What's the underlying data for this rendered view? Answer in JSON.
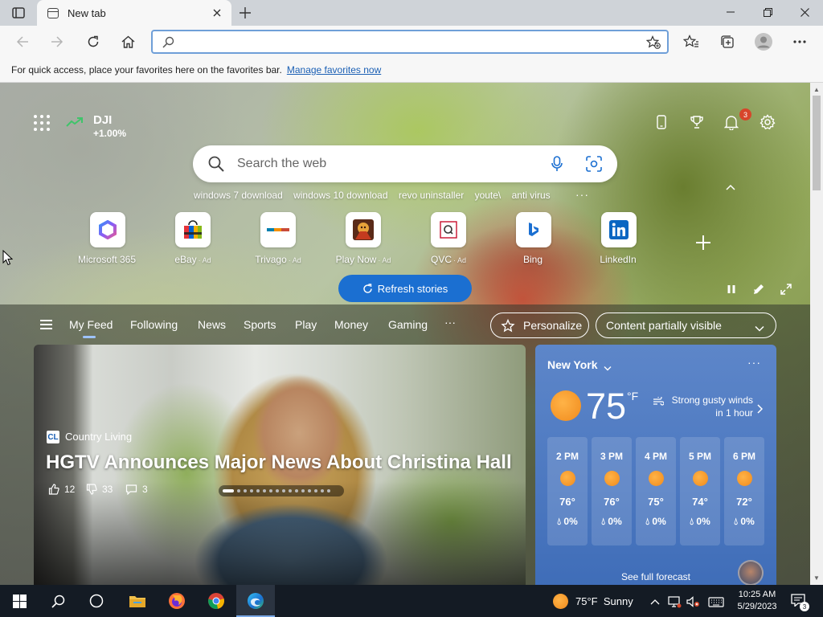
{
  "browser": {
    "tab_title": "New tab",
    "address_value": "",
    "favorites_prompt": "For quick access, place your favorites here on the favorites bar.",
    "favorites_link": "Manage favorites now"
  },
  "top_row": {
    "stock_symbol": "DJI",
    "stock_change": "+1.00%",
    "notification_count": "3"
  },
  "search": {
    "placeholder": "Search the web",
    "suggestions": [
      "windows 7 download",
      "windows 10 download",
      "revo uninstaller",
      "youte\\",
      "anti virus"
    ],
    "more": "···"
  },
  "quick_links": [
    {
      "label": "Microsoft 365",
      "ad": ""
    },
    {
      "label": "eBay",
      "ad": "· Ad"
    },
    {
      "label": "Trivago",
      "ad": "· Ad"
    },
    {
      "label": "Play Now",
      "ad": "· Ad"
    },
    {
      "label": "QVC",
      "ad": "· Ad"
    },
    {
      "label": "Bing",
      "ad": ""
    },
    {
      "label": "LinkedIn",
      "ad": ""
    }
  ],
  "feed": {
    "tabs": [
      "My Feed",
      "Following",
      "News",
      "Sports",
      "Play",
      "Money",
      "Gaming"
    ],
    "more": "···",
    "personalize": "Personalize",
    "content_visibility": "Content partially visible",
    "refresh": "Refresh stories"
  },
  "hero": {
    "source_badge": "CL",
    "source": "Country Living",
    "headline": "HGTV Announces Major News About Christina Hall",
    "likes": "12",
    "dislikes": "33",
    "comments": "3",
    "slide_count": 16,
    "active_slide": 1
  },
  "weather": {
    "city": "New York",
    "more": "···",
    "temperature": "75",
    "unit": "°F",
    "alert": "Strong gusty winds in 1 hour",
    "hourly": [
      {
        "time": "2 PM",
        "temp": "76°",
        "precip": "0%"
      },
      {
        "time": "3 PM",
        "temp": "76°",
        "precip": "0%"
      },
      {
        "time": "4 PM",
        "temp": "75°",
        "precip": "0%"
      },
      {
        "time": "5 PM",
        "temp": "74°",
        "precip": "0%"
      },
      {
        "time": "6 PM",
        "temp": "72°",
        "precip": "0%"
      }
    ],
    "full_forecast": "See full forecast"
  },
  "taskbar": {
    "weather_temp": "75°F",
    "weather_cond": "Sunny",
    "time": "10:25 AM",
    "date": "5/29/2023",
    "notification_count": "3"
  },
  "colors": {
    "accent": "#1b6fd1",
    "weather_card": "#4c78c0",
    "notification_badge": "#d7452a",
    "taskbar": "#141b24"
  }
}
